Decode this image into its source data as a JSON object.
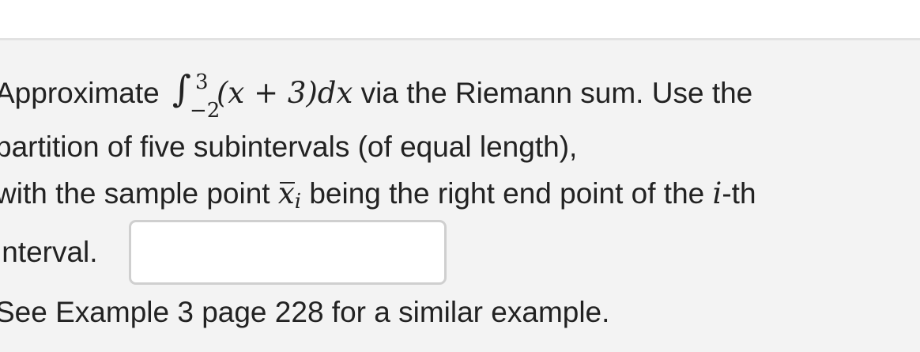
{
  "question": {
    "line1": {
      "before": "Approximate",
      "integral_sign": "∫",
      "upper_limit": "3",
      "lower_limit": "−2",
      "integrand": "(x + 3)dx",
      "after": " via the Riemann sum. Use the"
    },
    "line2": "partition of five subintervals (of equal length),",
    "line3": {
      "before": "with the sample point ",
      "sample_var": "x",
      "sample_sub": "i",
      "middle": " being the right end point of the ",
      "index_var": "i",
      "after": "-th"
    },
    "line4": "interval.",
    "answer": {
      "value": "",
      "placeholder": ""
    },
    "line5": "See Example 3 page 228 for a similar example."
  }
}
